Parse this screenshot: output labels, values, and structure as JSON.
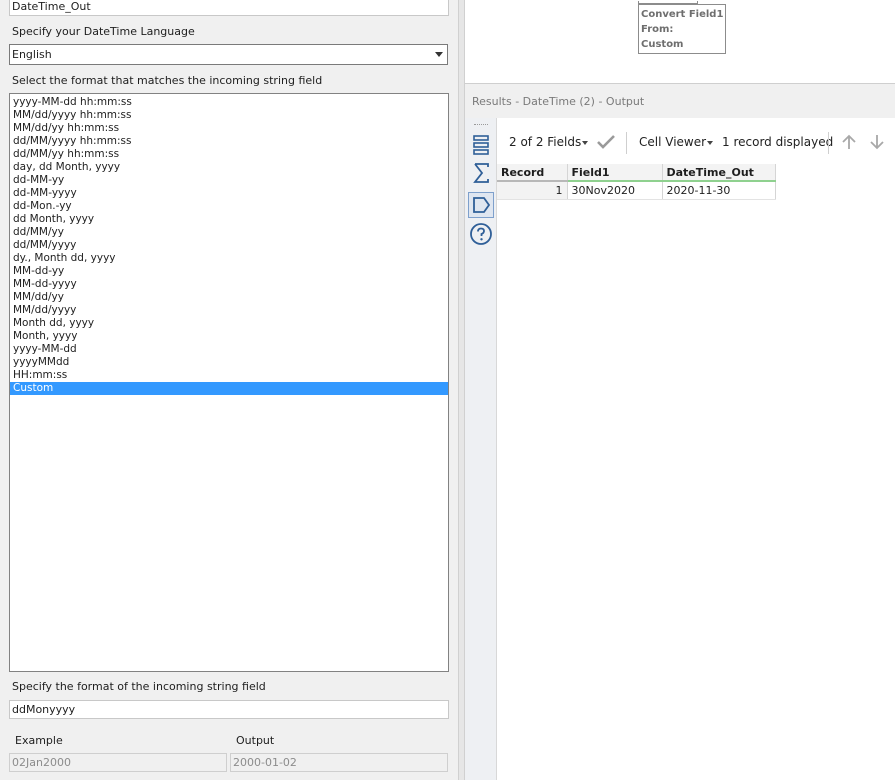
{
  "config": {
    "output_field_name": "DateTime_Out",
    "language_label": "Specify your DateTime Language",
    "language_value": "English",
    "format_list_label": "Select the format that matches the incoming string field",
    "formats": [
      "yyyy-MM-dd hh:mm:ss",
      "MM/dd/yyyy hh:mm:ss",
      "MM/dd/yy hh:mm:ss",
      "dd/MM/yyyy hh:mm:ss",
      "dd/MM/yy hh:mm:ss",
      "day, dd Month, yyyy",
      "dd-MM-yy",
      "dd-MM-yyyy",
      "dd-Mon.-yy",
      "dd Month, yyyy",
      "dd/MM/yy",
      "dd/MM/yyyy",
      "dy., Month dd, yyyy",
      "MM-dd-yy",
      "MM-dd-yyyy",
      "MM/dd/yy",
      "MM/dd/yyyy",
      "Month dd, yyyy",
      "Month, yyyy",
      "yyyy-MM-dd",
      "yyyyMMdd",
      "HH:mm:ss",
      "Custom"
    ],
    "selected_format": "Custom",
    "custom_format_label": "Specify the format of the incoming string field",
    "custom_format_value": "ddMonyyyy",
    "example_label": "Example",
    "example_value": "02Jan2000",
    "output_label": "Output",
    "output_value": "2000-01-02"
  },
  "canvas": {
    "annotation_lines": [
      "Convert Field1",
      "From:",
      "Custom"
    ]
  },
  "results": {
    "title": "Results - DateTime (2) - Output",
    "fields_label": "2 of 2 Fields",
    "cell_viewer_label": "Cell Viewer",
    "records_label": "1 record displayed",
    "columns": [
      "Record",
      "Field1",
      "DateTime_Out"
    ],
    "rows": [
      [
        "1",
        "30Nov2020",
        "2020-11-30"
      ]
    ]
  },
  "colors": {
    "selection": "#3399ff",
    "column_ok": "#8fd18f",
    "icon_blue": "#2f5f98"
  }
}
